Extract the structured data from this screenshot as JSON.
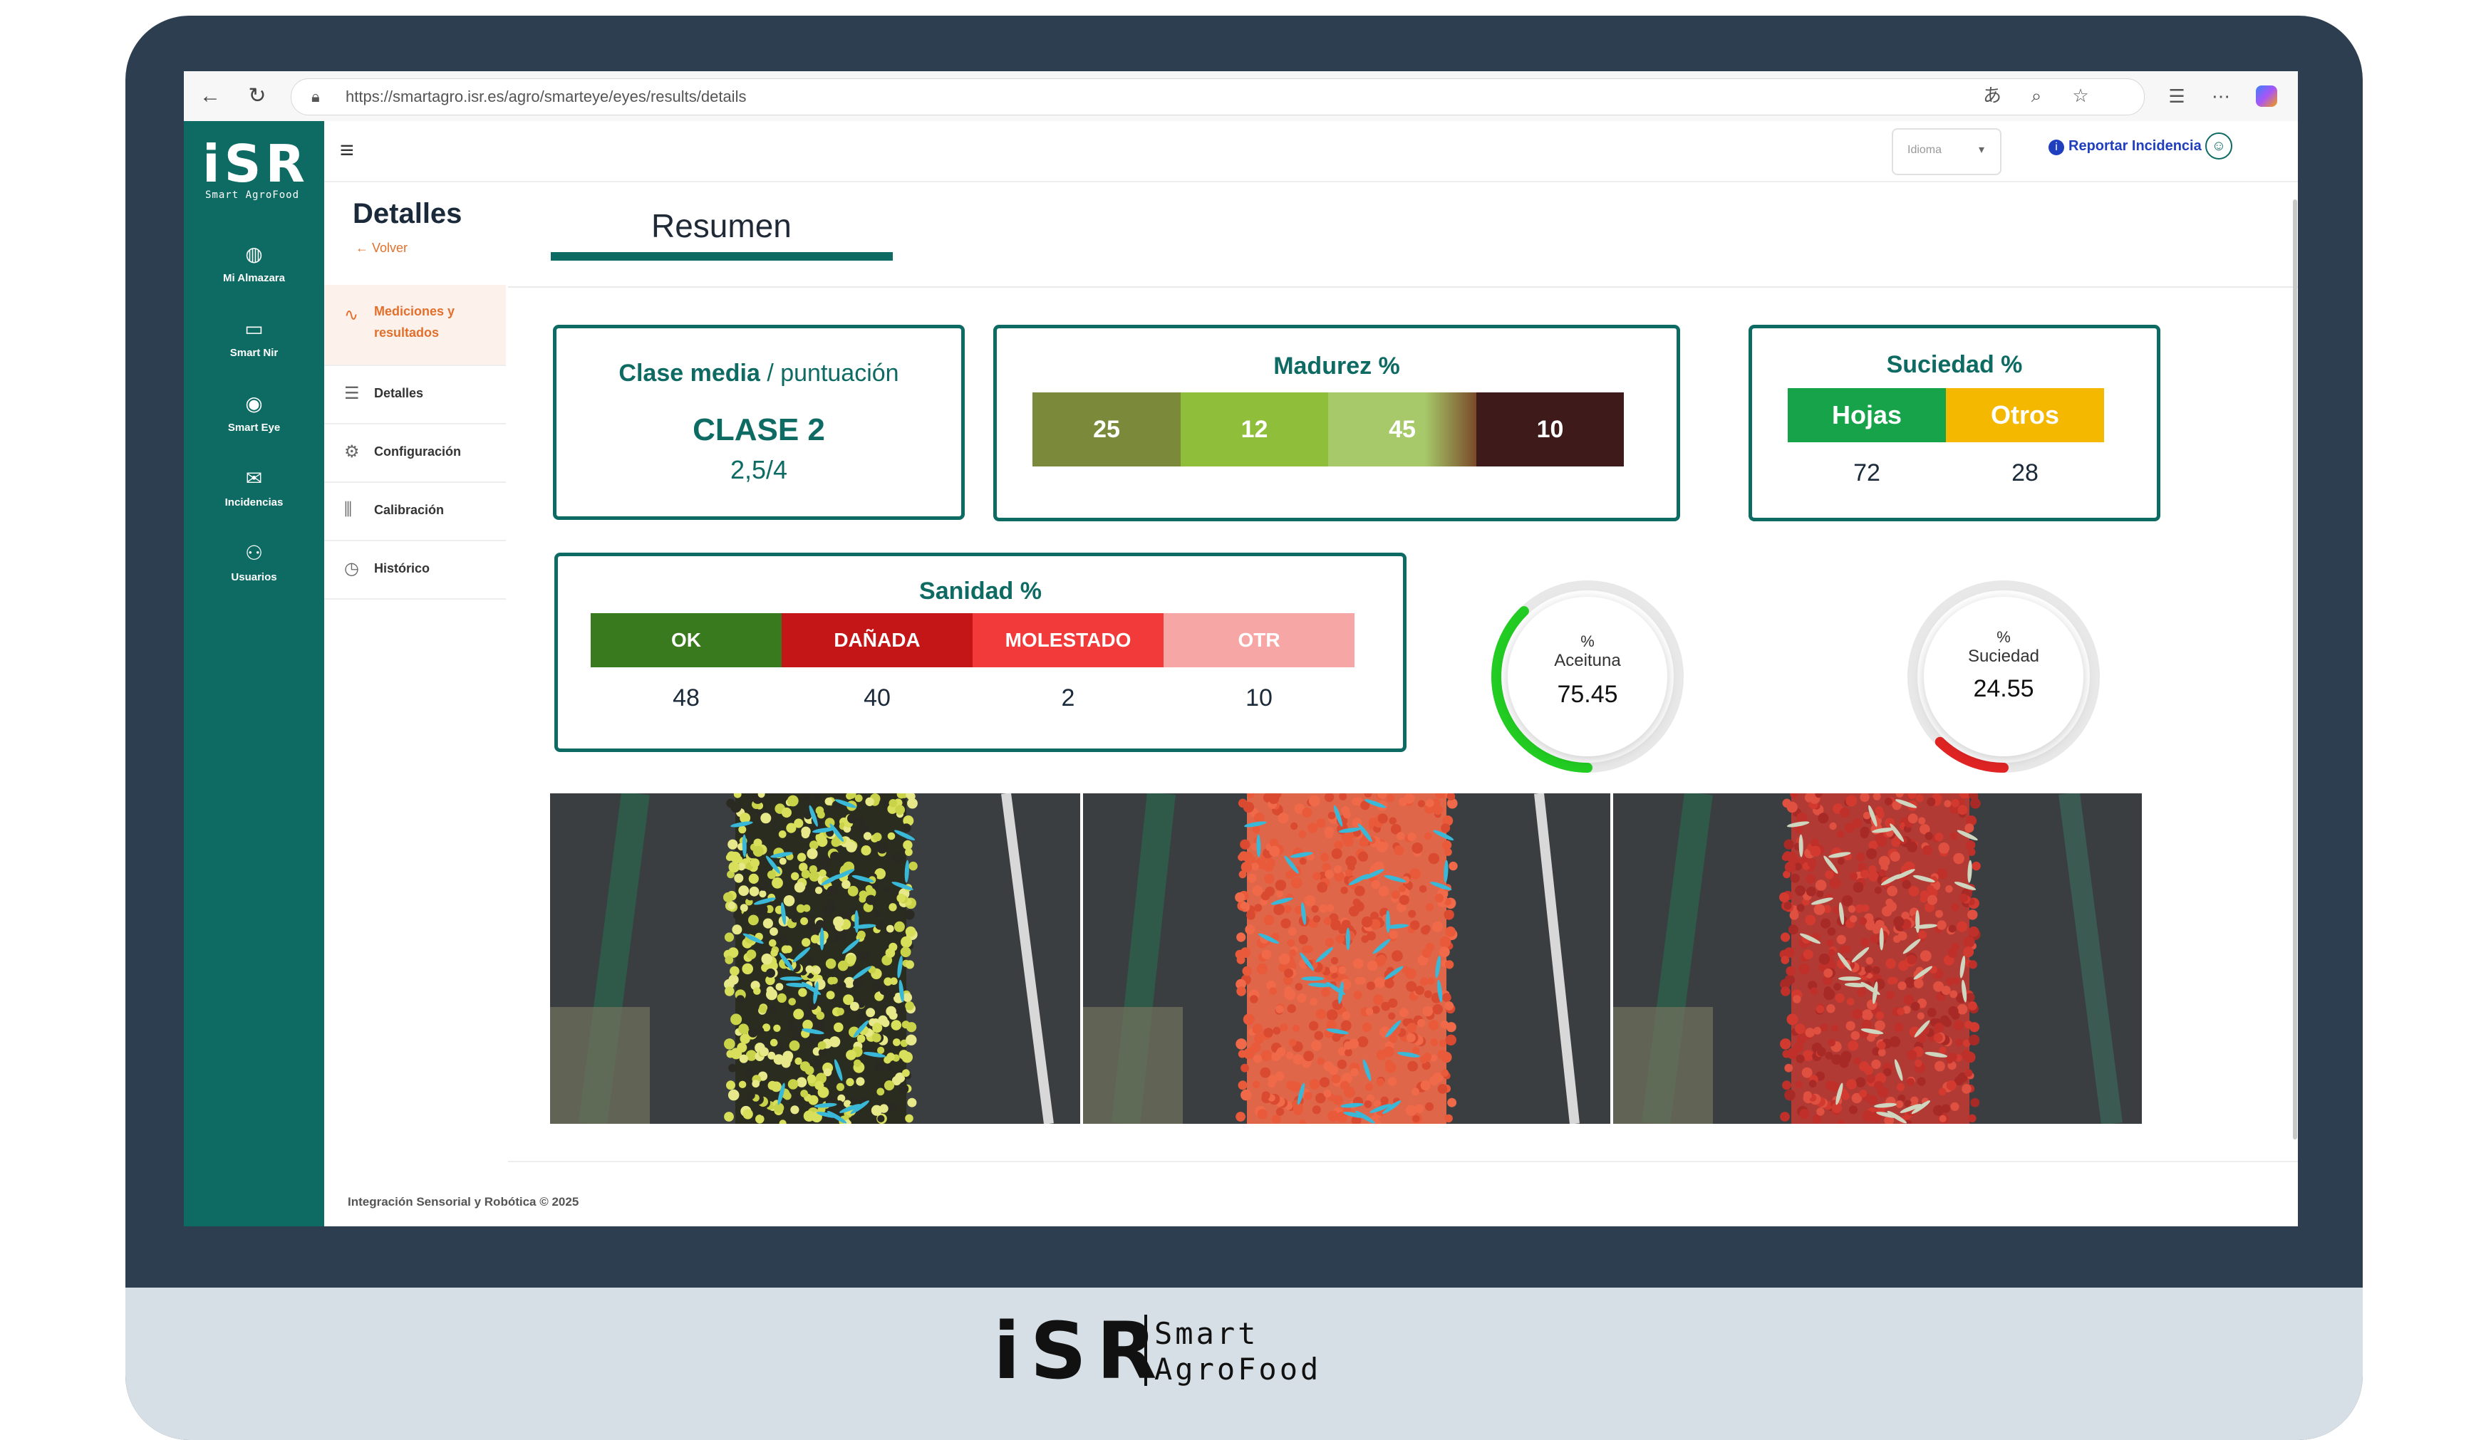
{
  "browser": {
    "url": "https://smartagro.isr.es/agro/smarteye/eyes/results/details"
  },
  "brand": {
    "logo": "iSR",
    "logo_sub": "Smart AgroFood",
    "bezel_logo": "iSR",
    "bezel_line1": "Smart",
    "bezel_line2": "AgroFood"
  },
  "sidebar": {
    "items": [
      {
        "label": "Mi Almazara",
        "icon": "factory-icon"
      },
      {
        "label": "Smart Nir",
        "icon": "scanner-icon"
      },
      {
        "label": "Smart Eye",
        "icon": "eye-device-icon"
      },
      {
        "label": "Incidencias",
        "icon": "mail-icon"
      },
      {
        "label": "Usuarios",
        "icon": "users-icon"
      }
    ]
  },
  "topbar": {
    "language_placeholder": "Idioma",
    "report_label": "Reportar Incidencia"
  },
  "subnav": {
    "title": "Detalles",
    "back_label": "Volver",
    "items": [
      {
        "label": "Mediciones y resultados",
        "icon": "pulse-icon",
        "active": true
      },
      {
        "label": "Detalles",
        "icon": "list-icon",
        "active": false
      },
      {
        "label": "Configuración",
        "icon": "gear-icon",
        "active": false
      },
      {
        "label": "Calibración",
        "icon": "sliders-icon",
        "active": false
      },
      {
        "label": "Histórico",
        "icon": "clock-icon",
        "active": false
      }
    ]
  },
  "tabs": {
    "active": "Resumen"
  },
  "clase": {
    "title_bold": "Clase media",
    "title_rest": " / puntuación",
    "value": "CLASE 2",
    "score": "2,5/4"
  },
  "madurez": {
    "title": "Madurez %",
    "values": [
      25,
      12,
      45,
      10
    ],
    "colors": [
      "#7a8a3a",
      "#8fbf3a",
      "#a7c96a",
      "#3e1a1a"
    ]
  },
  "suciedad": {
    "title": "Suciedad %",
    "labels": [
      "Hojas",
      "Otros"
    ],
    "values": [
      72,
      28
    ],
    "colors": [
      "#16a34a",
      "#f5b800"
    ]
  },
  "sanidad": {
    "title": "Sanidad %",
    "labels": [
      "OK",
      "DAÑADA",
      "MOLESTADO",
      "OTR"
    ],
    "values": [
      48,
      40,
      2,
      10
    ],
    "colors": [
      "#3a7a1e",
      "#c41616",
      "#f23a3a",
      "#f7a6a6"
    ]
  },
  "gauges": [
    {
      "symbol": "%",
      "label": "Aceituna",
      "value": "75.45",
      "percent": 0.7545,
      "color": "#22cc22"
    },
    {
      "symbol": "%",
      "label": "Suciedad",
      "value": "24.55",
      "percent": 0.2455,
      "color": "#e02424"
    }
  ],
  "footer": {
    "text": "Integración Sensorial y Robótica © 2025"
  }
}
